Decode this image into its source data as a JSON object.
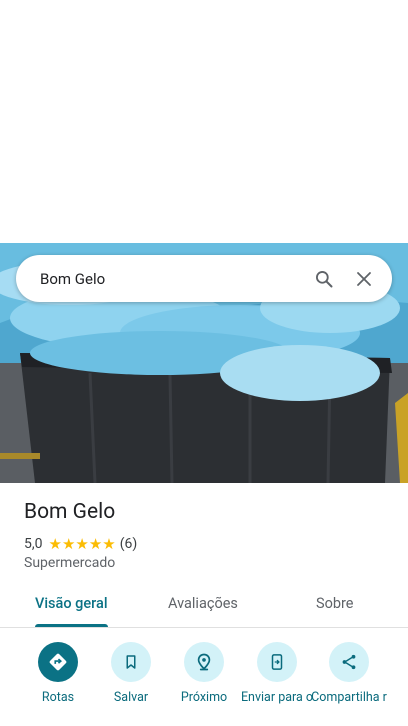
{
  "search": {
    "query": "Bom Gelo"
  },
  "place": {
    "name": "Bom Gelo",
    "rating": "5,0",
    "stars": "★★★★★",
    "review_count": "(6)",
    "category": "Supermercado"
  },
  "tabs": [
    "Visão geral",
    "Avaliações",
    "Sobre"
  ],
  "actions": [
    {
      "label": "Rotas",
      "icon": "directions-icon"
    },
    {
      "label": "Salvar",
      "icon": "bookmark-icon"
    },
    {
      "label": "Próximo",
      "icon": "nearby-icon"
    },
    {
      "label": "Enviar para o",
      "icon": "send-to-phone-icon"
    },
    {
      "label": "Compartilha r",
      "icon": "share-icon"
    }
  ],
  "colors": {
    "accent": "#0b7285",
    "action_bg": "#d3f2f8",
    "star": "#fbbc04"
  }
}
